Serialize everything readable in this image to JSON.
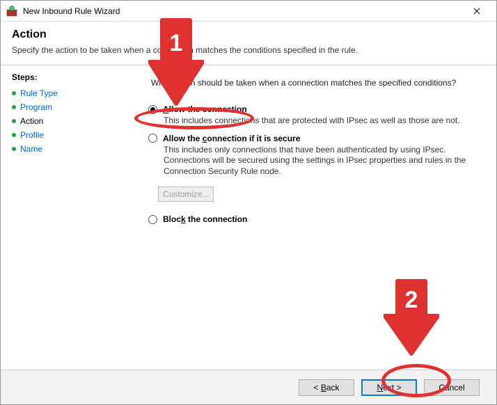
{
  "window": {
    "title": "New Inbound Rule Wizard"
  },
  "header": {
    "title": "Action",
    "subtitle": "Specify the action to be taken when a connection matches the conditions specified in the rule."
  },
  "sidebar": {
    "steps_label": "Steps:",
    "items": [
      {
        "label": "Rule Type",
        "current": false
      },
      {
        "label": "Program",
        "current": false
      },
      {
        "label": "Action",
        "current": true
      },
      {
        "label": "Profile",
        "current": false
      },
      {
        "label": "Name",
        "current": false
      }
    ]
  },
  "content": {
    "prompt": "What action should be taken when a connection matches the specified conditions?",
    "options": [
      {
        "label_pre": "",
        "label_ul": "A",
        "label_post": "llow the connection",
        "desc": "This includes connections that are protected with IPsec as well as those are not.",
        "checked": true
      },
      {
        "label_pre": "Allow the ",
        "label_ul": "c",
        "label_post": "onnection if it is secure",
        "desc": "This includes only connections that have been authenticated by using IPsec.  Connections will be secured using the settings in IPsec properties and rules in the Connection Security Rule node.",
        "checked": false
      },
      {
        "label_pre": "Bloc",
        "label_ul": "k",
        "label_post": " the connection",
        "desc": "",
        "checked": false
      }
    ],
    "customize_label": "Customize..."
  },
  "buttons": {
    "back_pre": "< ",
    "back_ul": "B",
    "back_post": "ack",
    "next_ul": "N",
    "next_post": "ext >",
    "cancel": "Cancel"
  },
  "annotations": {
    "callout1": "1",
    "callout2": "2"
  }
}
